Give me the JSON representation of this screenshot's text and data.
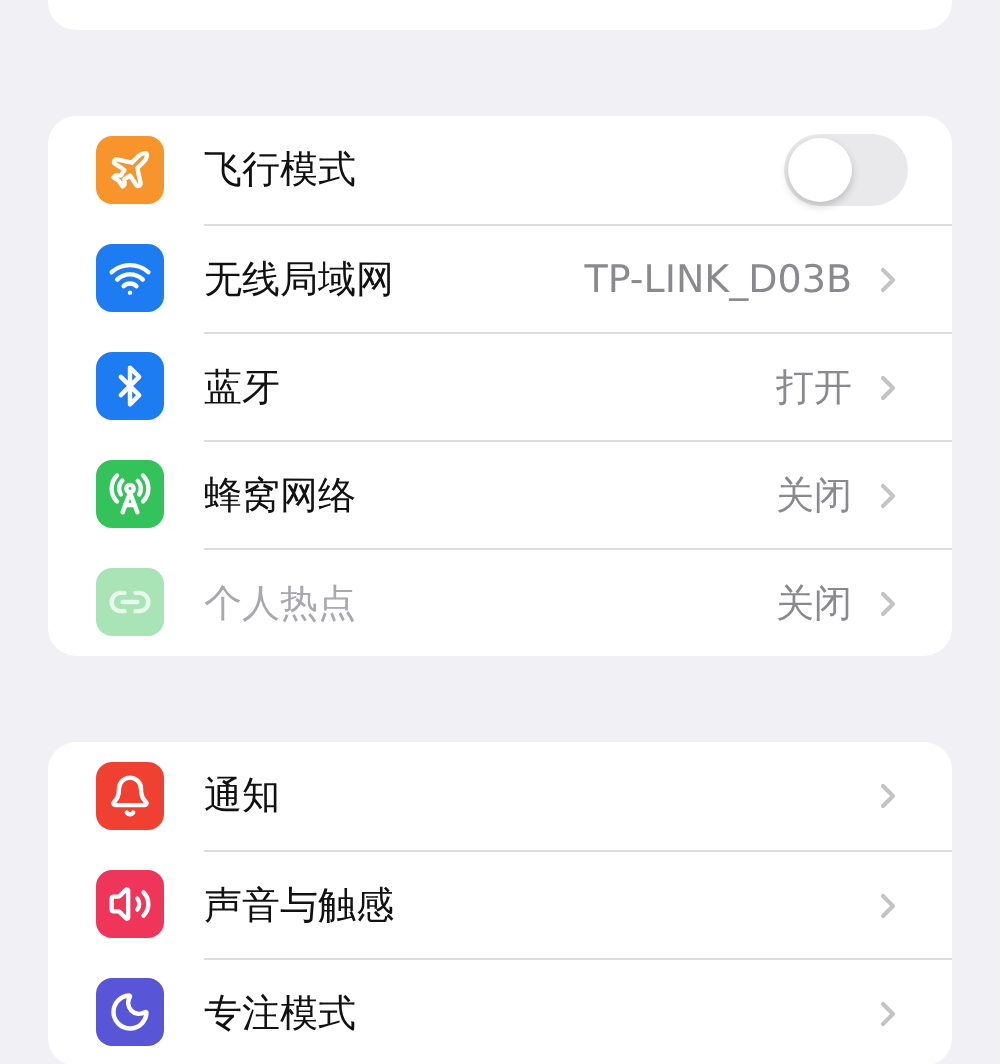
{
  "groups": [
    {
      "rows": [
        {
          "kind": "toggle",
          "label": "飞行模式",
          "color": "#f7952c",
          "on": false,
          "disabled": false
        },
        {
          "kind": "link",
          "label": "无线局域网",
          "value": "TP-LINK_D03B",
          "color": "#1d7cf2",
          "disabled": false
        },
        {
          "kind": "link",
          "label": "蓝牙",
          "value": "打开",
          "color": "#1d7cf2",
          "disabled": false
        },
        {
          "kind": "link",
          "label": "蜂窝网络",
          "value": "关闭",
          "color": "#34c25a",
          "disabled": false
        },
        {
          "kind": "link",
          "label": "个人热点",
          "value": "关闭",
          "color": "#a8e4b6",
          "disabled": true
        }
      ]
    },
    {
      "rows": [
        {
          "kind": "link",
          "label": "通知",
          "color": "#f04032",
          "disabled": false
        },
        {
          "kind": "link",
          "label": "声音与触感",
          "color": "#f0355a",
          "disabled": false
        },
        {
          "kind": "link",
          "label": "专注模式",
          "color": "#5856d6",
          "disabled": false
        }
      ]
    }
  ]
}
